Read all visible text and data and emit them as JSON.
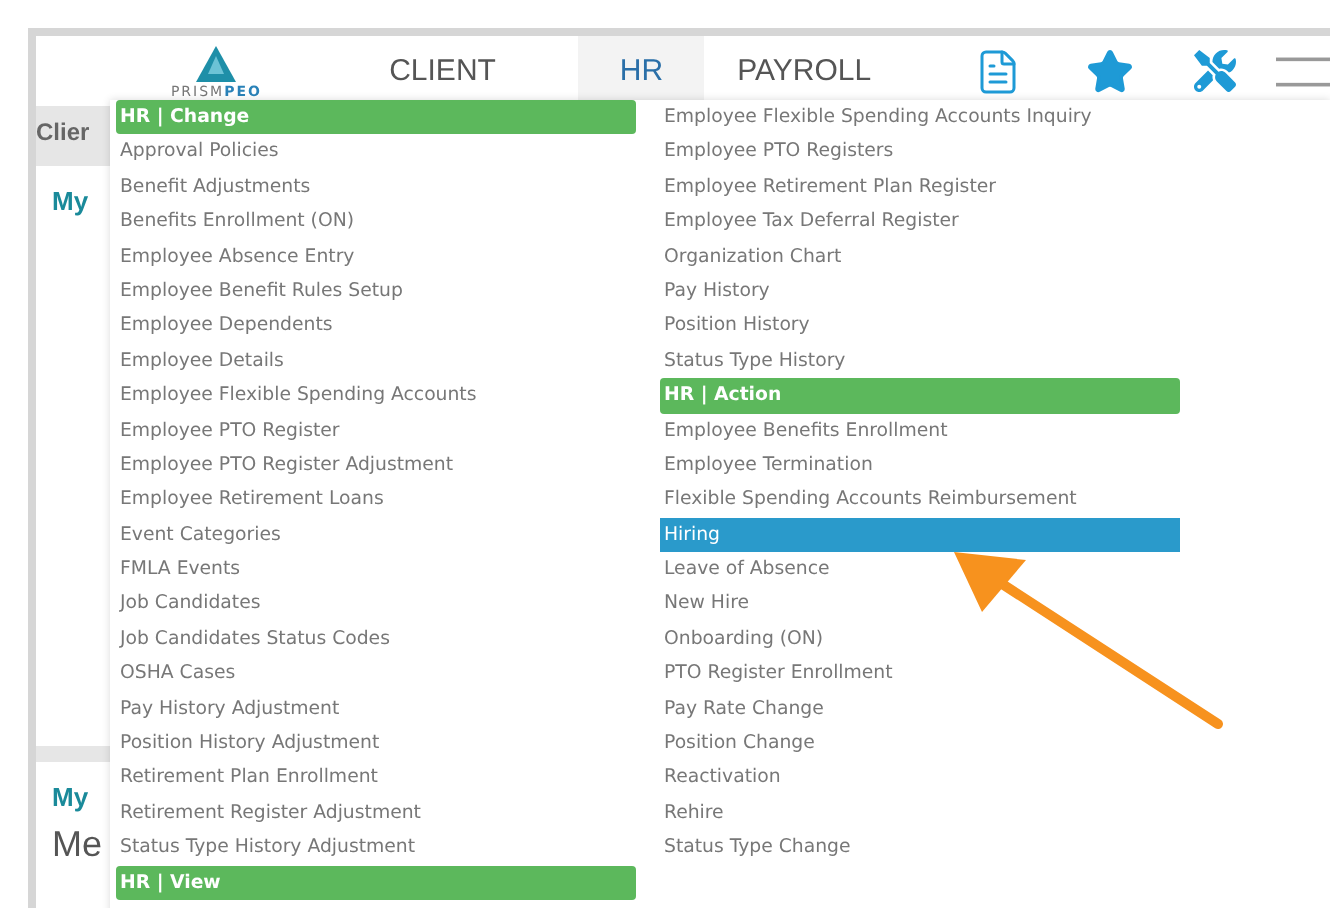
{
  "header": {
    "logo": {
      "part_1": "PRISM",
      "part_2": "PEO"
    },
    "tabs": [
      {
        "label": "CLIENT",
        "selected": false
      },
      {
        "label": "HR",
        "selected": true
      },
      {
        "label": "PAYROLL",
        "selected": false
      }
    ]
  },
  "background": {
    "section_title": "Clier",
    "card_titles": [
      "My",
      "My"
    ],
    "card_text": "Me"
  },
  "menu": {
    "columns": [
      [
        {
          "kind": "header",
          "label": "HR | Change"
        },
        {
          "kind": "item",
          "label": "Approval Policies",
          "selected": false
        },
        {
          "kind": "item",
          "label": "Benefit Adjustments",
          "selected": false
        },
        {
          "kind": "item",
          "label": "Benefits Enrollment (ON)",
          "selected": false
        },
        {
          "kind": "item",
          "label": "Employee Absence Entry",
          "selected": false
        },
        {
          "kind": "item",
          "label": "Employee Benefit Rules Setup",
          "selected": false
        },
        {
          "kind": "item",
          "label": "Employee Dependents",
          "selected": false
        },
        {
          "kind": "item",
          "label": "Employee Details",
          "selected": false
        },
        {
          "kind": "item",
          "label": "Employee Flexible Spending Accounts",
          "selected": false
        },
        {
          "kind": "item",
          "label": "Employee PTO Register",
          "selected": false
        },
        {
          "kind": "item",
          "label": "Employee PTO Register Adjustment",
          "selected": false
        },
        {
          "kind": "item",
          "label": "Employee Retirement Loans",
          "selected": false
        },
        {
          "kind": "item",
          "label": "Event Categories",
          "selected": false
        },
        {
          "kind": "item",
          "label": "FMLA Events",
          "selected": false
        },
        {
          "kind": "item",
          "label": "Job Candidates",
          "selected": false
        },
        {
          "kind": "item",
          "label": "Job Candidates Status Codes",
          "selected": false
        },
        {
          "kind": "item",
          "label": "OSHA Cases",
          "selected": false
        },
        {
          "kind": "item",
          "label": "Pay History Adjustment",
          "selected": false
        },
        {
          "kind": "item",
          "label": "Position History Adjustment",
          "selected": false
        },
        {
          "kind": "item",
          "label": "Retirement Plan Enrollment",
          "selected": false
        },
        {
          "kind": "item",
          "label": "Retirement Register Adjustment",
          "selected": false
        },
        {
          "kind": "item",
          "label": "Status Type History Adjustment",
          "selected": false
        },
        {
          "kind": "header",
          "label": "HR | View"
        }
      ],
      [
        {
          "kind": "item",
          "label": "Employee Flexible Spending Accounts Inquiry",
          "selected": false
        },
        {
          "kind": "item",
          "label": "Employee PTO Registers",
          "selected": false
        },
        {
          "kind": "item",
          "label": "Employee Retirement Plan Register",
          "selected": false
        },
        {
          "kind": "item",
          "label": "Employee Tax Deferral Register",
          "selected": false
        },
        {
          "kind": "item",
          "label": "Organization Chart",
          "selected": false
        },
        {
          "kind": "item",
          "label": "Pay History",
          "selected": false
        },
        {
          "kind": "item",
          "label": "Position History",
          "selected": false
        },
        {
          "kind": "item",
          "label": "Status Type History",
          "selected": false
        },
        {
          "kind": "header",
          "label": "HR | Action"
        },
        {
          "kind": "item",
          "label": "Employee Benefits Enrollment",
          "selected": false
        },
        {
          "kind": "item",
          "label": "Employee Termination",
          "selected": false
        },
        {
          "kind": "item",
          "label": "Flexible Spending Accounts Reimbursement",
          "selected": false
        },
        {
          "kind": "item",
          "label": "Hiring",
          "selected": true
        },
        {
          "kind": "item",
          "label": "Leave of Absence",
          "selected": false
        },
        {
          "kind": "item",
          "label": "New Hire",
          "selected": false
        },
        {
          "kind": "item",
          "label": "Onboarding (ON)",
          "selected": false
        },
        {
          "kind": "item",
          "label": "PTO Register Enrollment",
          "selected": false
        },
        {
          "kind": "item",
          "label": "Pay Rate Change",
          "selected": false
        },
        {
          "kind": "item",
          "label": "Position Change",
          "selected": false
        },
        {
          "kind": "item",
          "label": "Reactivation",
          "selected": false
        },
        {
          "kind": "item",
          "label": "Rehire",
          "selected": false
        },
        {
          "kind": "item",
          "label": "Status Type Change",
          "selected": false
        }
      ]
    ]
  }
}
